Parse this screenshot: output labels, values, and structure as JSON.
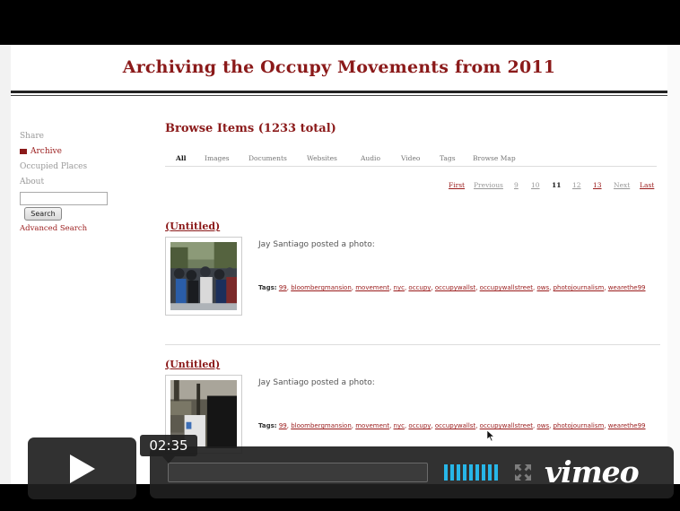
{
  "site": {
    "title": "Archiving the Occupy Movements from 2011"
  },
  "sidebar": {
    "items": [
      {
        "label": "Share"
      },
      {
        "label": "Archive"
      },
      {
        "label": "Occupied Places"
      },
      {
        "label": "About"
      }
    ],
    "search_button": "Search",
    "advanced_search": "Advanced Search",
    "search_value": ""
  },
  "main": {
    "browse_title": "Browse Items (1233 total)",
    "tabs": [
      {
        "label": "All"
      },
      {
        "label": "Images"
      },
      {
        "label": "Documents"
      },
      {
        "label": "Websites"
      },
      {
        "label": "Audio"
      },
      {
        "label": "Video"
      },
      {
        "label": "Tags"
      },
      {
        "label": "Browse Map"
      }
    ],
    "active_tab": "All",
    "pagination": {
      "first": "First",
      "previous": "Previous",
      "pages": [
        "9",
        "10",
        "11",
        "12",
        "13"
      ],
      "current_page": "11",
      "next": "Next",
      "last": "Last"
    },
    "items": [
      {
        "title": "(Untitled)",
        "description": "Jay Santiago posted a photo:",
        "tags_label": "Tags:",
        "tags": [
          "99",
          "bloombergmansion",
          "movement",
          "nyc",
          "occupy",
          "occupywallst",
          "occupywallstreet",
          "ows",
          "photojournalism",
          "wearethe99"
        ]
      },
      {
        "title": "(Untitled)",
        "description": "Jay Santiago posted a photo:",
        "tags_label": "Tags:",
        "tags": [
          "99",
          "bloombergmansion",
          "movement",
          "nyc",
          "occupy",
          "occupywallst",
          "occupywallstreet",
          "ows",
          "photojournalism",
          "wearethe99"
        ]
      }
    ]
  },
  "player": {
    "time": "02:35",
    "logo": "vimeo",
    "accent_color": "#27b6e8",
    "icons": [
      "play-icon",
      "volume-icon",
      "fullscreen-icon",
      "vimeo-logo"
    ]
  }
}
